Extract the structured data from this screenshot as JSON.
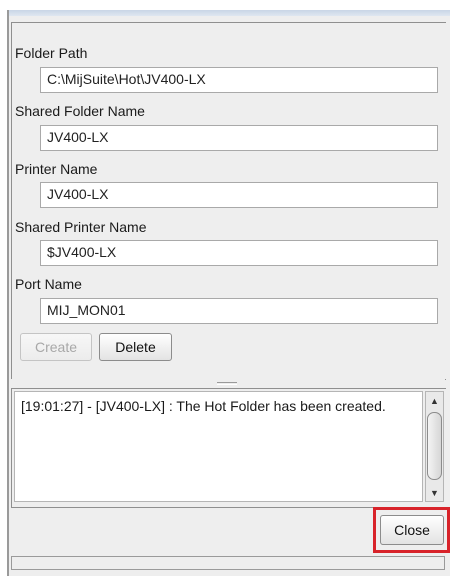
{
  "form": {
    "folder_path": {
      "label": "Folder Path",
      "value": "C:\\MijSuite\\Hot\\JV400-LX"
    },
    "shared_folder_name": {
      "label": "Shared Folder Name",
      "value": "JV400-LX"
    },
    "printer_name": {
      "label": "Printer Name",
      "value": "JV400-LX"
    },
    "shared_printer_name": {
      "label": "Shared Printer Name",
      "value": "$JV400-LX"
    },
    "port_name": {
      "label": "Port Name",
      "value": "MIJ_MON01"
    },
    "create_label": "Create",
    "delete_label": "Delete"
  },
  "log": {
    "text": "[19:01:27] - [JV400-LX] : The Hot Folder has been created."
  },
  "footer": {
    "close_label": "Close"
  },
  "colors": {
    "highlight": "#d8232a",
    "panel_bg": "#eeeeee"
  }
}
